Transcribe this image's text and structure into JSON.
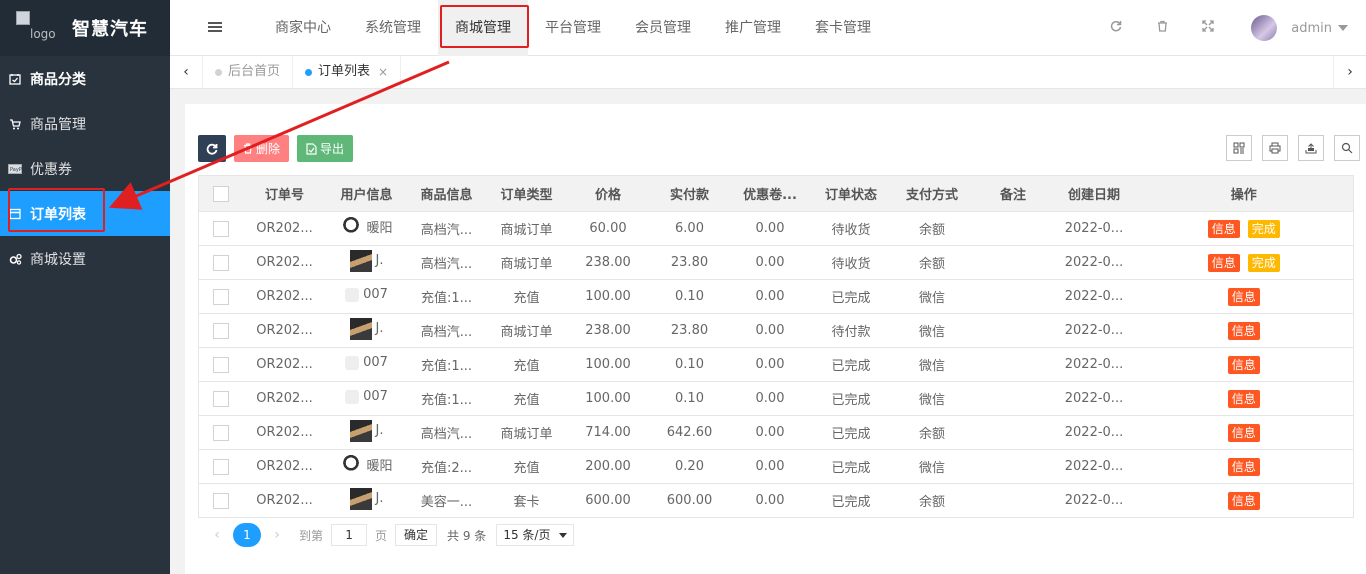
{
  "brand": {
    "logo_alt": "logo",
    "title": "智慧汽车"
  },
  "sidebar": {
    "items": [
      {
        "label": "商品分类",
        "icon": "calendar-check-icon"
      },
      {
        "label": "商品管理",
        "icon": "cart-icon"
      },
      {
        "label": "优惠券",
        "icon": "paypal-icon"
      },
      {
        "label": "订单列表",
        "icon": "list-card-icon",
        "active": true
      },
      {
        "label": "商城设置",
        "icon": "cogs-icon"
      }
    ]
  },
  "header": {
    "nav": [
      "商家中心",
      "系统管理",
      "商城管理",
      "平台管理",
      "会员管理",
      "推广管理",
      "套卡管理"
    ],
    "active_nav": "商城管理",
    "user": "admin"
  },
  "tabs": {
    "items": [
      {
        "label": "后台首页"
      },
      {
        "label": "订单列表",
        "active": true
      }
    ]
  },
  "toolbar": {
    "delete_label": "删除",
    "export_label": "导出"
  },
  "table": {
    "headers": [
      "订单号",
      "用户信息",
      "商品信息",
      "订单类型",
      "价格",
      "实付款",
      "优惠卷...",
      "订单状态",
      "支付方式",
      "备注",
      "创建日期",
      "操作"
    ],
    "rows": [
      {
        "order": "OR202...",
        "user": "暖阳",
        "avatar": "a",
        "product": "高档汽...",
        "type": "商城订单",
        "price": "60.00",
        "paid": "6.00",
        "coupon": "0.00",
        "status": "待收货",
        "pay": "余额",
        "note": "",
        "date": "2022-0...",
        "actions": [
          "信息",
          "完成"
        ]
      },
      {
        "order": "OR202...",
        "user": "J.",
        "avatar": "b",
        "product": "高档汽...",
        "type": "商城订单",
        "price": "238.00",
        "paid": "23.80",
        "coupon": "0.00",
        "status": "待收货",
        "pay": "余额",
        "note": "",
        "date": "2022-0...",
        "actions": [
          "信息",
          "完成"
        ]
      },
      {
        "order": "OR202...",
        "user": "007",
        "avatar": "c",
        "product": "充值:1...",
        "type": "充值",
        "price": "100.00",
        "paid": "0.10",
        "coupon": "0.00",
        "status": "已完成",
        "pay": "微信",
        "note": "",
        "date": "2022-0...",
        "actions": [
          "信息"
        ]
      },
      {
        "order": "OR202...",
        "user": "J.",
        "avatar": "b",
        "product": "高档汽...",
        "type": "商城订单",
        "price": "238.00",
        "paid": "23.80",
        "coupon": "0.00",
        "status": "待付款",
        "pay": "微信",
        "note": "",
        "date": "2022-0...",
        "actions": [
          "信息"
        ]
      },
      {
        "order": "OR202...",
        "user": "007",
        "avatar": "c",
        "product": "充值:1...",
        "type": "充值",
        "price": "100.00",
        "paid": "0.10",
        "coupon": "0.00",
        "status": "已完成",
        "pay": "微信",
        "note": "",
        "date": "2022-0...",
        "actions": [
          "信息"
        ]
      },
      {
        "order": "OR202...",
        "user": "007",
        "avatar": "c",
        "product": "充值:1...",
        "type": "充值",
        "price": "100.00",
        "paid": "0.10",
        "coupon": "0.00",
        "status": "已完成",
        "pay": "微信",
        "note": "",
        "date": "2022-0...",
        "actions": [
          "信息"
        ]
      },
      {
        "order": "OR202...",
        "user": "J.",
        "avatar": "b",
        "product": "高档汽...",
        "type": "商城订单",
        "price": "714.00",
        "paid": "642.60",
        "coupon": "0.00",
        "status": "已完成",
        "pay": "余额",
        "note": "",
        "date": "2022-0...",
        "actions": [
          "信息"
        ]
      },
      {
        "order": "OR202...",
        "user": "暖阳",
        "avatar": "a",
        "product": "充值:2...",
        "type": "充值",
        "price": "200.00",
        "paid": "0.20",
        "coupon": "0.00",
        "status": "已完成",
        "pay": "微信",
        "note": "",
        "date": "2022-0...",
        "actions": [
          "信息"
        ]
      },
      {
        "order": "OR202...",
        "user": "J.",
        "avatar": "b",
        "product": "美容一...",
        "type": "套卡",
        "price": "600.00",
        "paid": "600.00",
        "coupon": "0.00",
        "status": "已完成",
        "pay": "余额",
        "note": "",
        "date": "2022-0...",
        "actions": [
          "信息"
        ]
      }
    ]
  },
  "pager": {
    "current_page": "1",
    "goto_prefix": "到第",
    "goto_value": "1",
    "goto_suffix": "页",
    "confirm": "确定",
    "total": "共 9 条",
    "page_size": "15 条/页"
  },
  "colors": {
    "sidebar": "#28333e",
    "active": "#1e9fff",
    "annotation": "#e02020",
    "info": "#ff5722",
    "done": "#ffb800"
  }
}
